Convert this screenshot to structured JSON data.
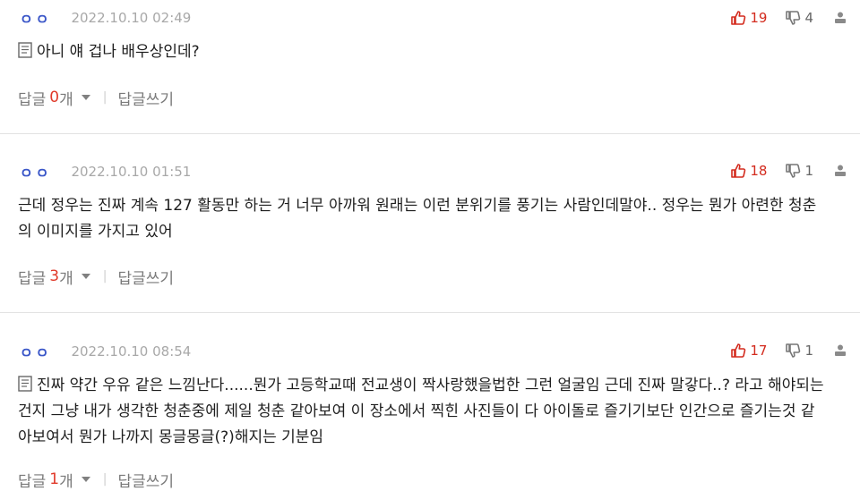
{
  "comments": [
    {
      "author": "ㅇㅇ",
      "date": "2022.10.10 02:49",
      "upvotes": "19",
      "downvotes": "4",
      "has_memo_icon": true,
      "lines": [
        "아니 얘 겁나 배우상인데?"
      ],
      "reply_label": "답글",
      "reply_count": "0",
      "reply_unit": "개",
      "separator": "|",
      "write_reply": "답글쓰기"
    },
    {
      "author": "ㅇㅇ",
      "date": "2022.10.10 01:51",
      "upvotes": "18",
      "downvotes": "1",
      "has_memo_icon": false,
      "lines": [
        "근데 정우는 진짜 계속 127 활동만 하는 거 너무 아까워 원래는 이런 분위기를 풍기는 사람인데말야.. 정우는 뭔가 아련한 청춘",
        "의 이미지를 가지고 있어"
      ],
      "reply_label": "답글",
      "reply_count": "3",
      "reply_unit": "개",
      "separator": "|",
      "write_reply": "답글쓰기"
    },
    {
      "author": "ㅇㅇ",
      "date": "2022.10.10 08:54",
      "upvotes": "17",
      "downvotes": "1",
      "has_memo_icon": true,
      "lines": [
        "진짜 약간 우유 같은 느낌난다......뭔가 고등학교때 전교생이 짝사랑했을법한 그런 얼굴임 근데 진짜 말갛다..? 라고 해야되는",
        "건지 그냥 내가 생각한 청춘중에 제일 청춘 같아보여 이 장소에서 찍힌 사진들이 다 아이돌로 즐기기보단 인간으로 즐기는것 같",
        "아보여서 뭔가 나까지 몽글몽글(?)해지는 기분임"
      ],
      "reply_label": "답글",
      "reply_count": "1",
      "reply_unit": "개",
      "separator": "|",
      "write_reply": "답글쓰기"
    }
  ],
  "icons": {
    "upvote": "thumbs-up-icon",
    "downvote": "thumbs-down-icon",
    "report": "report-icon",
    "memo": "memo-icon",
    "expand": "caret-down-icon"
  },
  "colors": {
    "author": "#3a56c8",
    "upvote": "#d32b1e",
    "reply_count": "#e03a2a"
  }
}
